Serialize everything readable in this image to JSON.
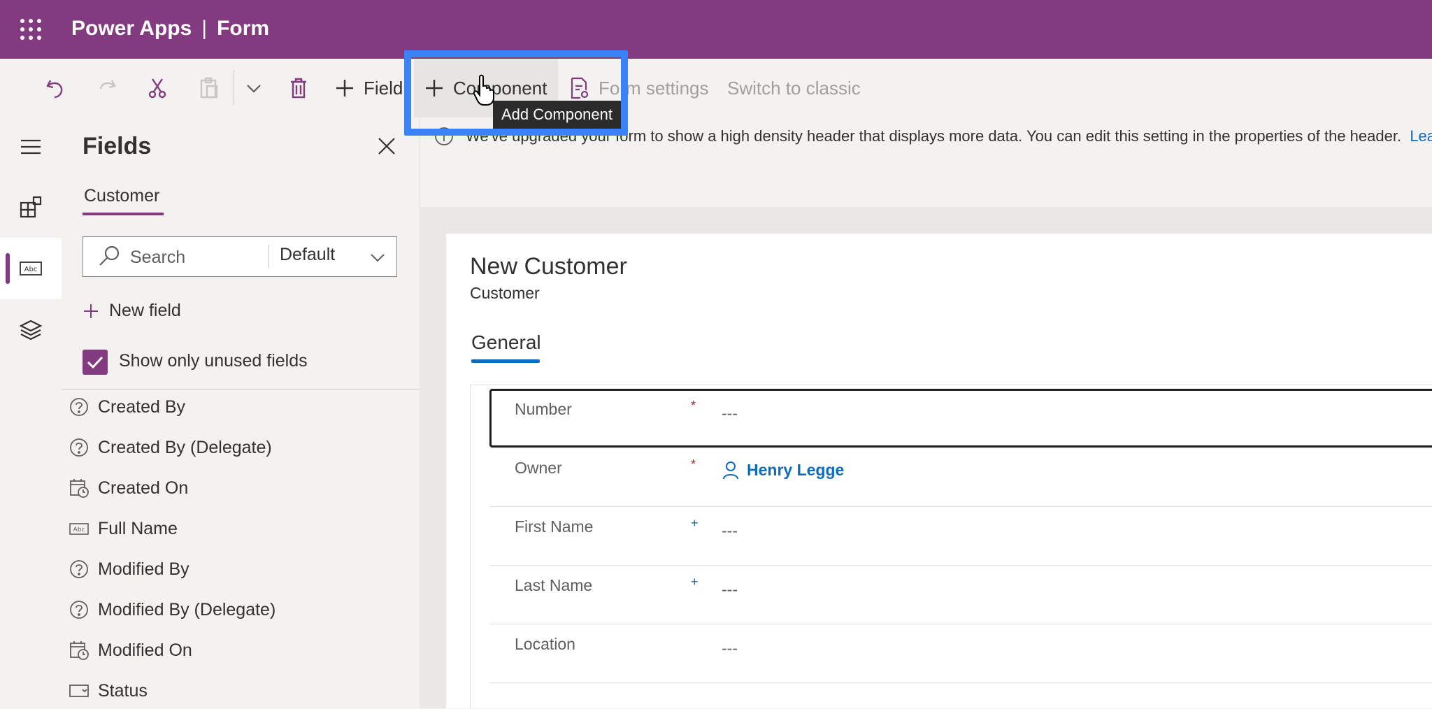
{
  "topbar": {
    "app_name": "Power Apps",
    "separator": "|",
    "page": "Form",
    "waffle_icon": "waffle-icon"
  },
  "toolbar": {
    "undo_icon": "undo-icon",
    "redo_icon": "redo-icon",
    "cut_icon": "cut-icon",
    "paste_icon": "paste-icon",
    "more_icon": "chevron-down-icon",
    "delete_icon": "delete-icon",
    "field_label": "Field",
    "component_label": "Component",
    "form_settings_label": "Form settings",
    "switch_classic_label": "Switch to classic",
    "tooltip": "Add Component"
  },
  "notification": {
    "text": "We've upgraded your form to show a high density header that displays more data. You can edit this setting in the properties of the header.",
    "link": "Lea"
  },
  "fields_panel": {
    "title": "Fields",
    "tab": "Customer",
    "search_placeholder": "Search",
    "filter_value": "Default",
    "new_field_label": "New field",
    "show_unused_label": "Show only unused fields",
    "show_unused_checked": true,
    "items": [
      {
        "label": "Created By",
        "icon": "help-circle-icon"
      },
      {
        "label": "Created By (Delegate)",
        "icon": "help-circle-icon"
      },
      {
        "label": "Created On",
        "icon": "calendar-clock-icon"
      },
      {
        "label": "Full Name",
        "icon": "text-field-icon"
      },
      {
        "label": "Modified By",
        "icon": "help-circle-icon"
      },
      {
        "label": "Modified By (Delegate)",
        "icon": "help-circle-icon"
      },
      {
        "label": "Modified On",
        "icon": "calendar-clock-icon"
      },
      {
        "label": "Status",
        "icon": "option-set-icon"
      }
    ]
  },
  "form": {
    "title": "New Customer",
    "subtitle": "Customer",
    "tab": "General",
    "rows": [
      {
        "label": "Number",
        "required": "*",
        "value": "---"
      },
      {
        "label": "Owner",
        "required": "*",
        "value": "Henry Legge"
      },
      {
        "label": "First Name",
        "required": "+",
        "value": "---"
      },
      {
        "label": "Last Name",
        "required": "+",
        "value": "---"
      },
      {
        "label": "Location",
        "required": "",
        "value": "---"
      }
    ]
  },
  "colors": {
    "brand": "#833b7f",
    "highlight": "#3b82f6",
    "link": "#0f6cbd",
    "required": "#a4262c",
    "recommended": "#0f6cbd"
  }
}
